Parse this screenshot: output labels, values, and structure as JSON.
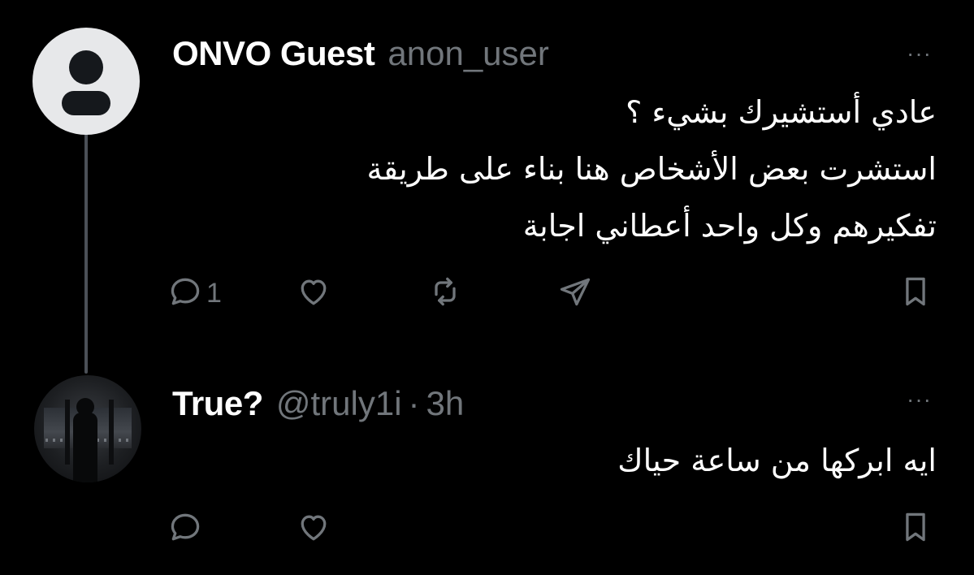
{
  "colors": {
    "background": "#000000",
    "text_primary": "#ffffff",
    "text_secondary": "#71767b",
    "thread_line": "#4b5057"
  },
  "posts": [
    {
      "display_name": "ONVO Guest",
      "handle": "anon_user",
      "more_icon": "···",
      "text_lines": [
        "عادي أستشيرك بشيء ؟",
        "استشرت بعض الأشخاص هنا بناء على طريقة",
        "تفكيرهم وكل واحد أعطاني اجابة"
      ],
      "actions": {
        "reply_count": "1",
        "icons": [
          "reply-icon",
          "like-icon",
          "repost-icon",
          "share-icon",
          "bookmark-icon"
        ]
      }
    },
    {
      "display_name": "True?",
      "handle": "@truly1i",
      "separator": "·",
      "time": "3h",
      "more_icon": "···",
      "text_lines": [
        "ايه ابركها من ساعة حياك"
      ],
      "actions": {
        "icons": [
          "reply-icon",
          "like-icon",
          "bookmark-icon"
        ]
      }
    }
  ]
}
